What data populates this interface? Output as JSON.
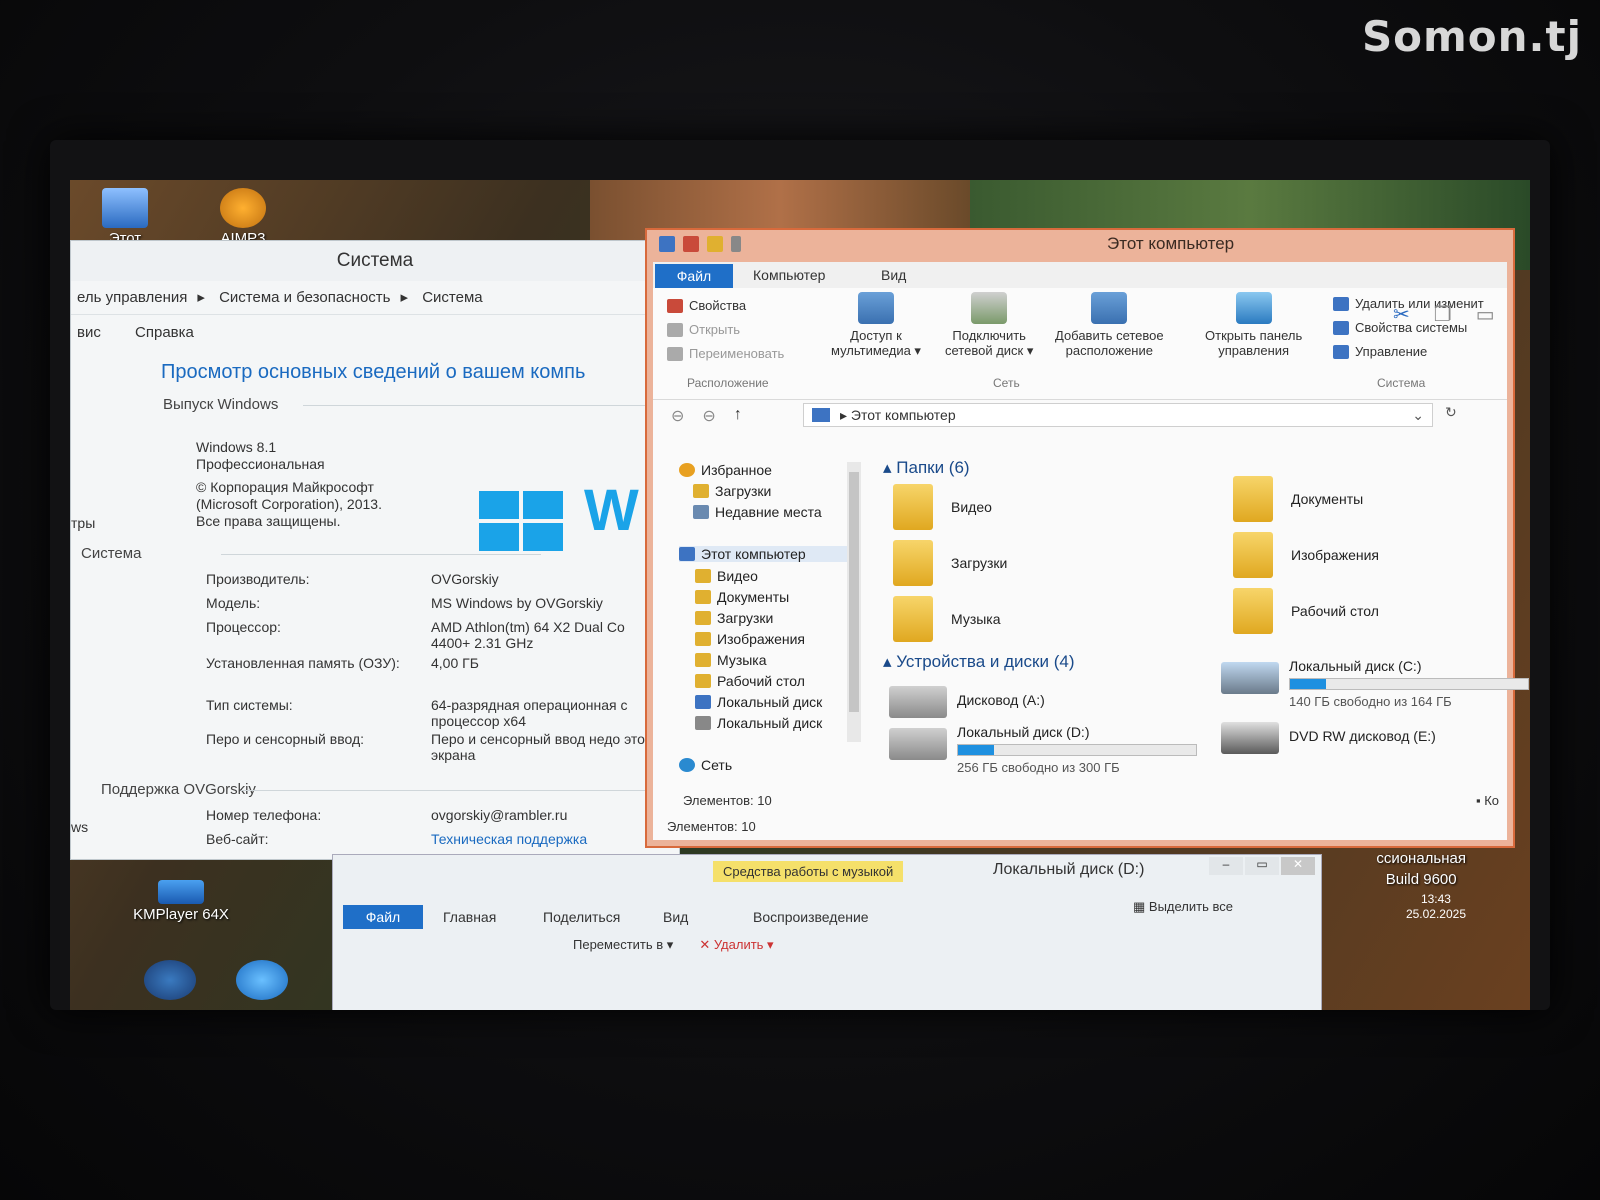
{
  "watermark": "Somon.tj",
  "desktop": {
    "icons": [
      {
        "label": "Этот"
      },
      {
        "label": "AIMP3"
      },
      {
        "label": "KMPlayer 64X"
      }
    ]
  },
  "system_window": {
    "title": "Система",
    "breadcrumb": [
      "ель управления",
      "Система и безопасность",
      "Система"
    ],
    "menu": [
      "вис",
      "Справка"
    ],
    "heading": "Просмотр основных сведений о вашем компь",
    "edition_section": "Выпуск Windows",
    "edition_lines": [
      "Windows 8.1",
      "Профессиональная",
      "© Корпорация Майкрософт",
      "(Microsoft Corporation), 2013.",
      "Все права защищены."
    ],
    "logo_text": "W",
    "side_label_1": "тры",
    "side_label_2": "ws",
    "system_section": "Система",
    "rows": [
      {
        "k": "Производитель:",
        "v": "OVGorskiy"
      },
      {
        "k": "Модель:",
        "v": "MS Windows by OVGorskiy"
      },
      {
        "k": "Процессор:",
        "v": "AMD Athlon(tm) 64 X2 Dual Co 4400+   2.31 GHz"
      },
      {
        "k": "Установленная память (ОЗУ):",
        "v": "4,00 ГБ"
      },
      {
        "k": "Тип системы:",
        "v": "64-разрядная операционная с процессор x64"
      },
      {
        "k": "Перо и сенсорный ввод:",
        "v": "Перо и сенсорный ввод недо этого экрана"
      }
    ],
    "support_section": "Поддержка OVGorskiy",
    "support_rows": [
      {
        "k": "Номер телефона:",
        "v": "ovgorskiy@rambler.ru"
      },
      {
        "k": "Веб-сайт:",
        "v": "Техническая поддержка"
      }
    ]
  },
  "explorer": {
    "title": "Этот компьютер",
    "tabs": {
      "file": "Файл",
      "computer": "Компьютер",
      "view": "Вид"
    },
    "ribbon": {
      "small": [
        "Свойства",
        "Открыть",
        "Переименовать"
      ],
      "group_location": "Расположение",
      "big": [
        {
          "l1": "Доступ к",
          "l2": "мультимедиа ▾"
        },
        {
          "l1": "Подключить",
          "l2": "сетевой диск ▾"
        },
        {
          "l1": "Добавить сетевое",
          "l2": "расположение"
        },
        {
          "l1": "Открыть панель",
          "l2": "управления"
        }
      ],
      "group_network": "Сеть",
      "right": [
        "Удалить или изменит",
        "Свойства системы",
        "Управление"
      ],
      "group_system": "Система"
    },
    "address": "Этот компьютер",
    "nav": [
      {
        "label": "Избранное",
        "color": "#e8a020"
      },
      {
        "label": "Загрузки",
        "color": "#e0b030"
      },
      {
        "label": "Недавние места",
        "color": "#6a8ab0"
      },
      {
        "label": "Этот компьютер",
        "color": "#3d73c2"
      },
      {
        "label": "Видео",
        "color": "#e0b030"
      },
      {
        "label": "Документы",
        "color": "#e0b030"
      },
      {
        "label": "Загрузки",
        "color": "#e0b030"
      },
      {
        "label": "Изображения",
        "color": "#e0b030"
      },
      {
        "label": "Музыка",
        "color": "#e0b030"
      },
      {
        "label": "Рабочий стол",
        "color": "#e0b030"
      },
      {
        "label": "Локальный диск",
        "color": "#3d73c2"
      },
      {
        "label": "Локальный диск",
        "color": "#888"
      },
      {
        "label": "Сеть",
        "color": "#2a8ad0"
      }
    ],
    "folders_header": "Папки (6)",
    "folders": [
      "Видео",
      "Документы",
      "Загрузки",
      "Изображения",
      "Музыка",
      "Рабочий стол"
    ],
    "devices_header": "Устройства и диски (4)",
    "drives": [
      {
        "name": "Дисковод (A:)"
      },
      {
        "name": "Локальный диск (C:)",
        "free": "140 ГБ свободно из 164 ГБ",
        "used": 0.15
      },
      {
        "name": "Локальный диск (D:)",
        "free": "256 ГБ свободно из 300 ГБ",
        "used": 0.15
      },
      {
        "name": "DVD RW дисковод (E:)"
      }
    ],
    "status_inner": "Элементов: 10",
    "status": "Элементов: 10",
    "corner_label": "Ко"
  },
  "explorer2": {
    "title": "Локальный диск (D:)",
    "music_tools": "Средства работы с музыкой",
    "tabs": [
      "Файл",
      "Главная",
      "Поделиться",
      "Вид",
      "Воспроизведение"
    ],
    "actions": [
      "Переместить в ▾",
      "✕ Удалить ▾"
    ],
    "select_all": "Выделить все"
  },
  "corner": {
    "line1": "ссиональная",
    "line2": "Build 9600",
    "time": "13:43",
    "date": "25.02.2025"
  }
}
